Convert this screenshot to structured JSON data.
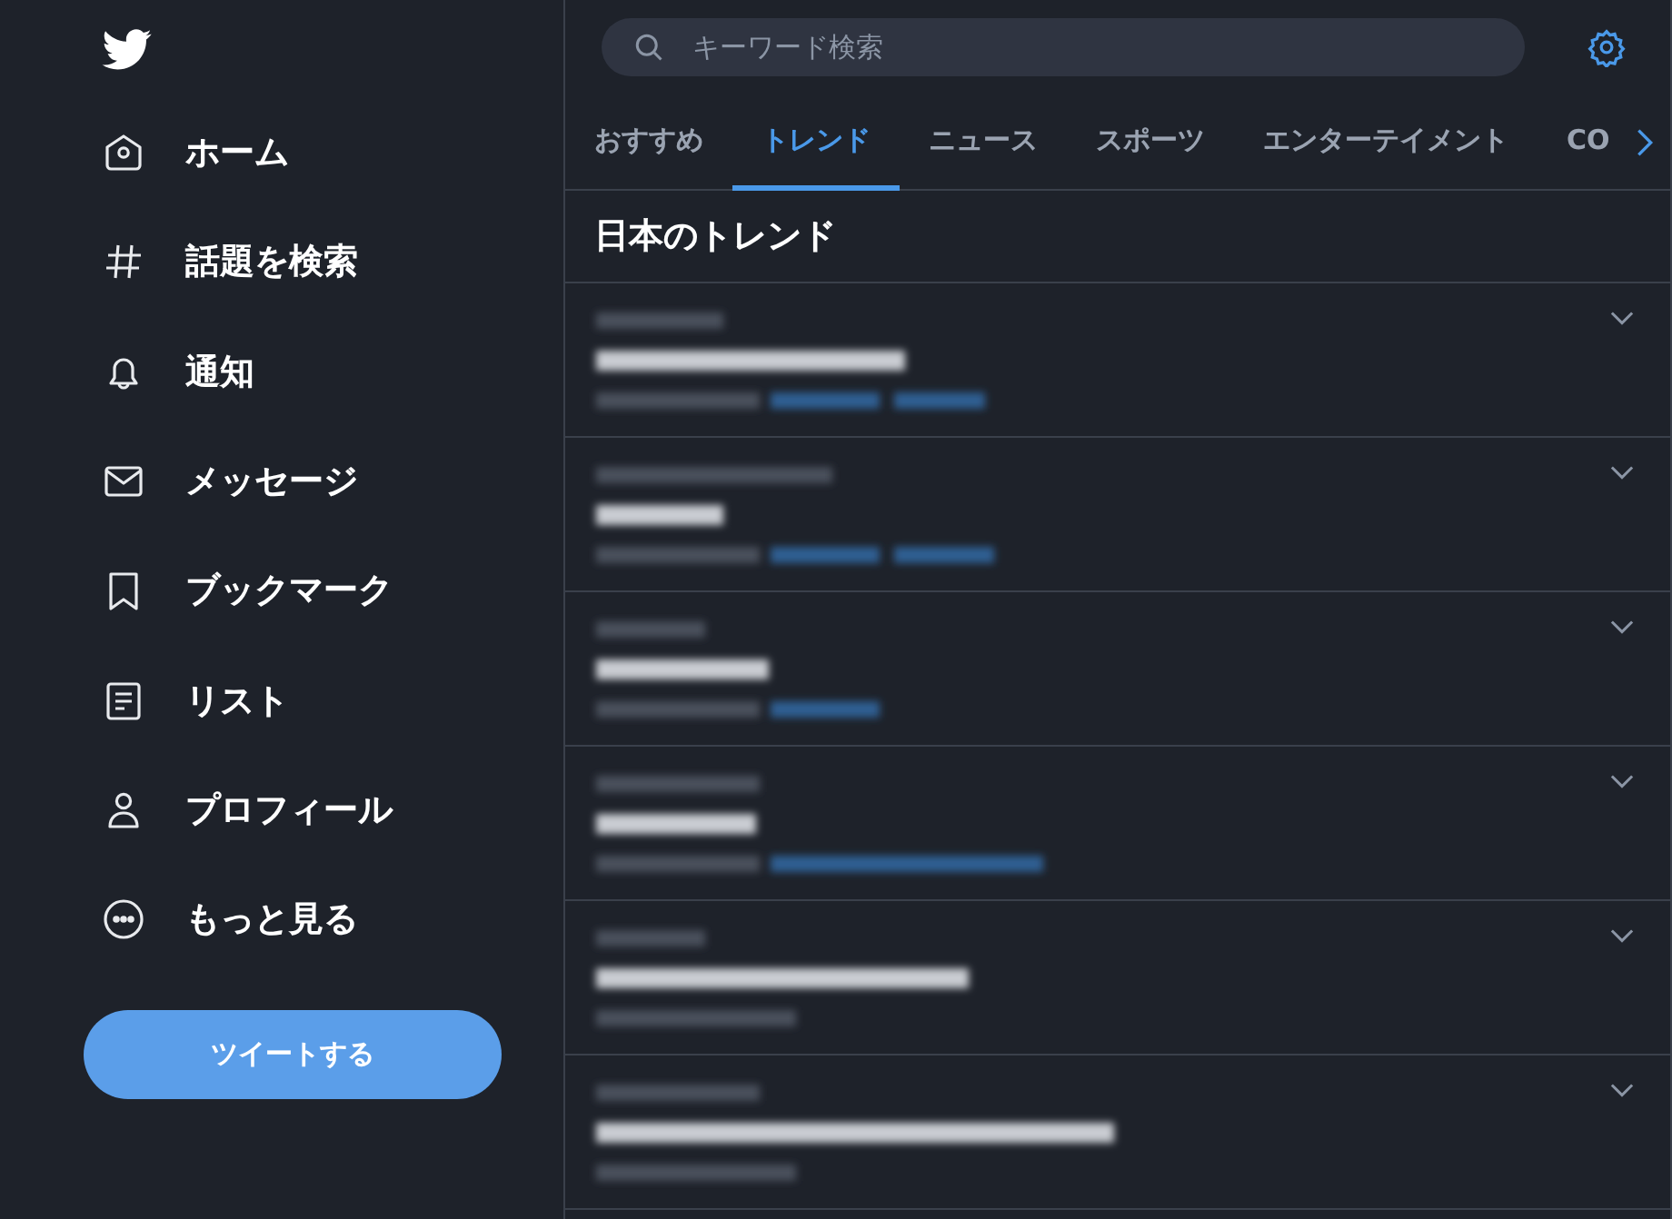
{
  "sidebar": {
    "items": [
      {
        "label": "ホーム"
      },
      {
        "label": "話題を検索"
      },
      {
        "label": "通知"
      },
      {
        "label": "メッセージ"
      },
      {
        "label": "ブックマーク"
      },
      {
        "label": "リスト"
      },
      {
        "label": "プロフィール"
      },
      {
        "label": "もっと見る"
      }
    ],
    "tweet_button": "ツイートする"
  },
  "search": {
    "placeholder": "キーワード検索"
  },
  "tabs": [
    {
      "label": "おすすめ",
      "selected": false
    },
    {
      "label": "トレンド",
      "selected": true
    },
    {
      "label": "ニュース",
      "selected": false
    },
    {
      "label": "スポーツ",
      "selected": false
    },
    {
      "label": "エンターテイメント",
      "selected": false
    },
    {
      "label": "CO",
      "selected": false
    }
  ],
  "section_title": "日本のトレンド",
  "trends": [
    {
      "kind": "blurred"
    },
    {
      "kind": "blurred"
    },
    {
      "kind": "blurred"
    },
    {
      "kind": "blurred"
    },
    {
      "kind": "blurred"
    },
    {
      "kind": "blurred"
    }
  ]
}
